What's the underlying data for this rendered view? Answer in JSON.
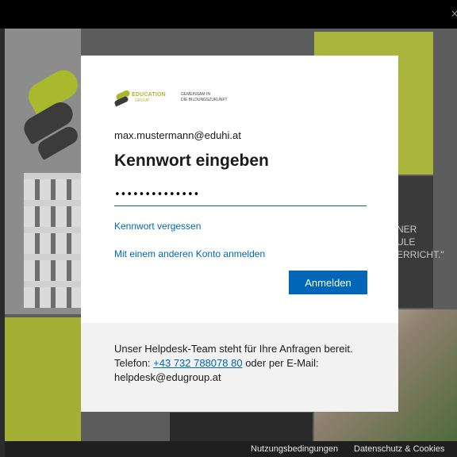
{
  "window": {
    "close_glyph": "×"
  },
  "background": {
    "text_lines": [
      "NER",
      "ULE",
      "ERRICHT.\""
    ]
  },
  "footer": {
    "terms": "Nutzungsbedingungen",
    "privacy": "Datenschutz & Cookies"
  },
  "dialog": {
    "logo": {
      "name": "EDUCATION",
      "sub": "GROUP",
      "tagline_1": "GEMEINSAM IN",
      "tagline_2": "DIE BILDUNGSZUKUNFT"
    },
    "email": "max.mustermann@eduhi.at",
    "heading": "Kennwort eingeben",
    "password_value": "••••••••••••••",
    "forgot_link": "Kennwort vergessen",
    "other_account_link": "Mit einem anderen Konto anmelden",
    "signin_button": "Anmelden",
    "help": {
      "line1": "Unser Helpdesk-Team steht für Ihre Anfragen bereit.",
      "phone_prefix": "Telefon: ",
      "phone": "+43 732 788078 80",
      "phone_suffix": " oder per E-Mail:",
      "email": "helpdesk@edugroup.at"
    }
  },
  "colors": {
    "accent": "#0067b8",
    "brand_green": "#a9b92e",
    "help_bg": "#f2f2f2"
  }
}
